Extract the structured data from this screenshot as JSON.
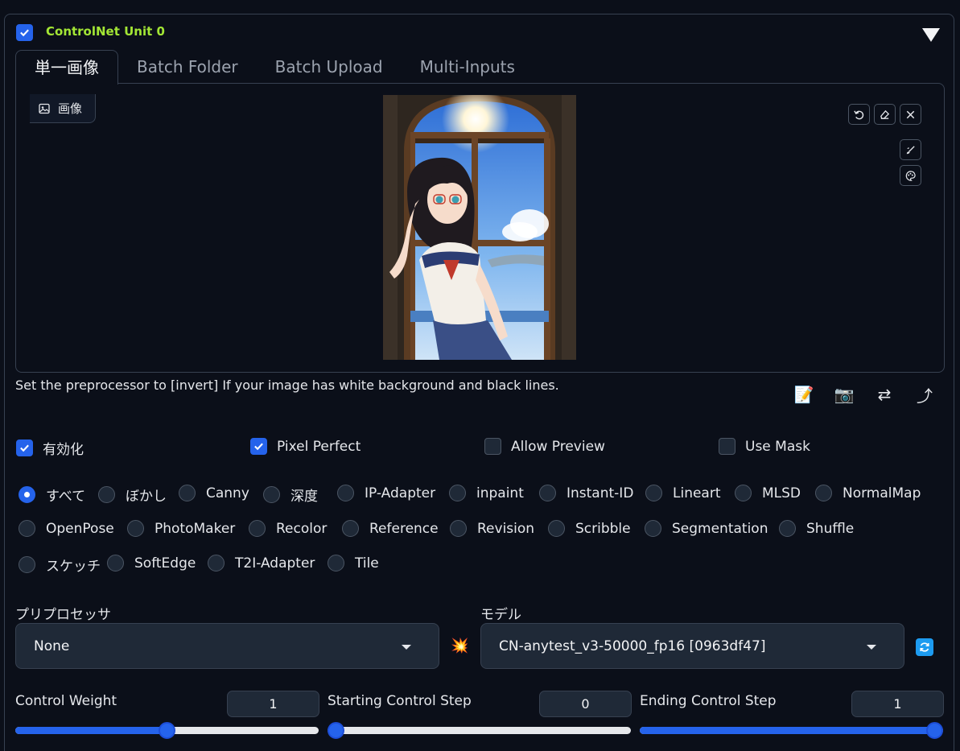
{
  "unit": {
    "title": "ControlNet Unit 0",
    "enabled": true
  },
  "tabs": [
    "単一画像",
    "Batch Folder",
    "Batch Upload",
    "Multi-Inputs"
  ],
  "image_panel": {
    "label": "画像"
  },
  "hint": "Set the preprocessor to [invert] If your image has white background and black lines.",
  "options": [
    {
      "label": "有効化",
      "checked": true
    },
    {
      "label": "Pixel Perfect",
      "checked": true
    },
    {
      "label": "Allow Preview",
      "checked": false
    },
    {
      "label": "Use Mask",
      "checked": false
    }
  ],
  "control_types": {
    "selected": "すべて",
    "rows": [
      [
        "すべて",
        "ぼかし",
        "Canny",
        "深度",
        "IP-Adapter",
        "inpaint",
        "Instant-ID",
        "Lineart",
        "MLSD",
        "NormalMap"
      ],
      [
        "OpenPose",
        "PhotoMaker",
        "Recolor",
        "Reference",
        "Revision",
        "Scribble",
        "Segmentation",
        "Shuffle"
      ],
      [
        "スケッチ",
        "SoftEdge",
        "T2I-Adapter",
        "Tile"
      ]
    ]
  },
  "preprocessor": {
    "label": "プリプロセッサ",
    "value": "None"
  },
  "model": {
    "label": "モデル",
    "value": "CN-anytest_v3-50000_fp16 [0963df47]"
  },
  "sliders": [
    {
      "label": "Control Weight",
      "value": "1",
      "fraction": 0.5
    },
    {
      "label": "Starting Control Step",
      "value": "0",
      "fraction": 0.0
    },
    {
      "label": "Ending Control Step",
      "value": "1",
      "fraction": 1.0
    }
  ],
  "colors": {
    "accent": "#2563eb",
    "title": "#a3e635",
    "background": "#0b0f19"
  }
}
